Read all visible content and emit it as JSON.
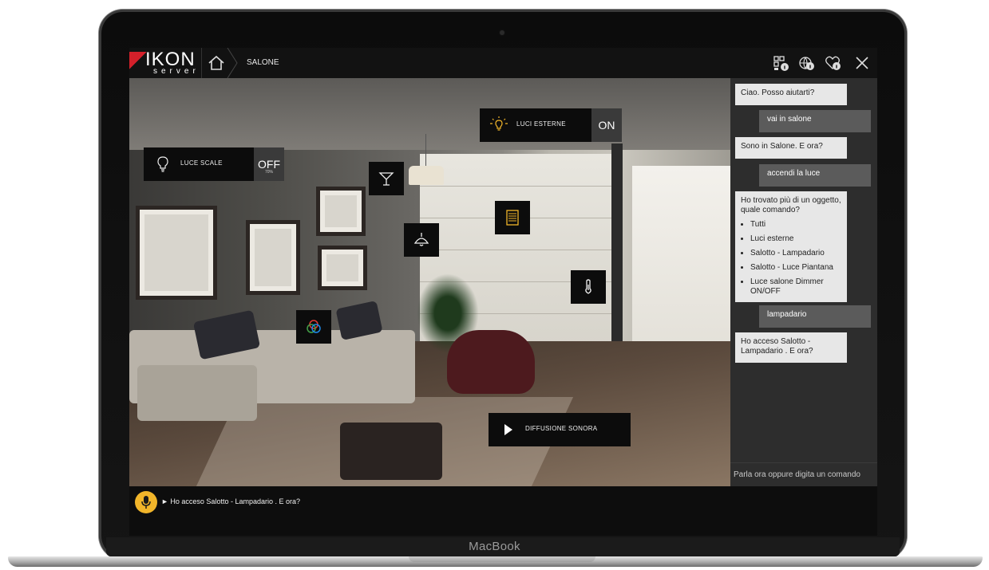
{
  "device": {
    "brand": "MacBook"
  },
  "app": {
    "logo": {
      "main": "IKON",
      "sub": "server"
    },
    "breadcrumb": "SALONE",
    "header_icons": [
      "qr-info-icon",
      "globe-info-icon",
      "heart-info-icon",
      "close-icon"
    ]
  },
  "controls": {
    "luce_scale": {
      "label": "LUCE SCALE",
      "state": "OFF",
      "sub": "70%",
      "icon": "bulb-icon"
    },
    "luci_esterne": {
      "label": "LUCI ESTERNE",
      "state": "ON",
      "icon": "bulb-on-icon"
    },
    "diffusione_sonora": {
      "label": "DIFFUSIONE SONORA",
      "icon": "play-icon"
    },
    "tiles": [
      "cocktail-glass-icon",
      "blind-icon",
      "ceiling-lamp-icon",
      "thermometer-icon",
      "rgb-color-icon"
    ]
  },
  "chat": {
    "messages": [
      {
        "from": "bot",
        "text": "Ciao. Posso aiutarti?"
      },
      {
        "from": "user",
        "text": "vai in salone"
      },
      {
        "from": "bot",
        "text": "Sono in Salone. E ora?"
      },
      {
        "from": "user",
        "text": "accendi la luce"
      },
      {
        "from": "bot",
        "text": "Ho trovato più di un oggetto, quale comando?",
        "options": [
          "Tutti",
          "Luci esterne",
          "Salotto - Lampadario",
          "Salotto - Luce Piantana",
          "Luce salone Dimmer ON/OFF"
        ]
      },
      {
        "from": "user",
        "text": "lampadario"
      },
      {
        "from": "bot",
        "text": "Ho acceso Salotto - Lampadario . E ora?"
      }
    ],
    "input_placeholder": "Parla ora oppure digita un comando"
  },
  "status": {
    "text": "► Ho acceso Salotto - Lampadario . E ora?",
    "mic_color": "#f1b52a"
  },
  "colors": {
    "logo_red": "#d3202a",
    "accent_yellow": "#f1b52a",
    "chat_bg": "#2d2d2d"
  }
}
